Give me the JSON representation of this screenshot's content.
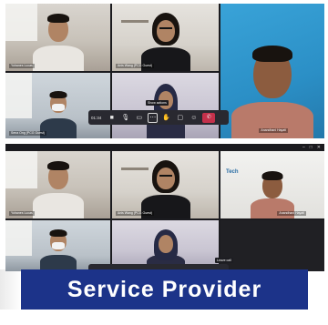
{
  "top_call": {
    "participants": [
      {
        "name": "Yohanes Lucas"
      },
      {
        "name": "Anis Wang (PCG Guest)"
      },
      {
        "name": "Anandhani Hayati"
      },
      {
        "name": "Sena Ong (PCG Guest)"
      },
      {
        "name": ""
      }
    ],
    "toolbar": {
      "timer": "01:34",
      "tooltip": "Show actions",
      "buttons": [
        "video-icon",
        "mic-icon",
        "share-icon",
        "more-icon",
        "raise-hand-icon",
        "chat-icon",
        "participants-icon",
        "leave-icon"
      ]
    }
  },
  "bottom_call": {
    "participants": [
      {
        "name": "Yohanes Lucas"
      },
      {
        "name": "Anis Wang (PCG Guest)"
      },
      {
        "name": "Anandhani Hayati"
      },
      {
        "name": "Sena Ong (PCG Guest)"
      }
    ],
    "window_controls": [
      "–",
      "□",
      "✕"
    ],
    "background_text": "Tech",
    "tooltip": "Leave call"
  },
  "caption": "Service Provider"
}
